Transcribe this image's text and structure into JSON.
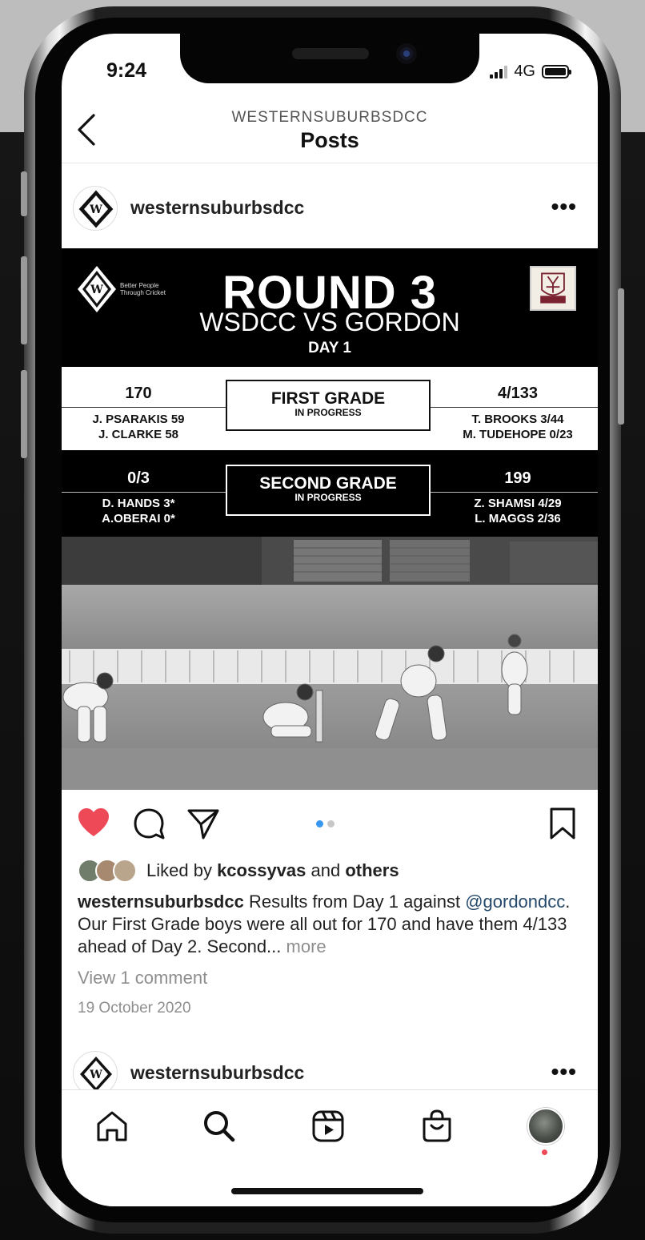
{
  "status": {
    "time": "9:24",
    "network": "4G"
  },
  "nav": {
    "account": "WESTERNSUBURBSDCC",
    "title": "Posts"
  },
  "post": {
    "username": "westernsuburbsdcc",
    "more": "•••",
    "graphic": {
      "tagline_line1": "Better People",
      "tagline_line2": "Through Cricket",
      "round": "ROUND 3",
      "match": "WSDCC VS GORDON",
      "day": "DAY 1",
      "gordon_badge": "GORDON DCC",
      "first_grade": {
        "label": "FIRST GRADE",
        "status": "IN PROGRESS",
        "left_score": "170",
        "left_line1": "J. PSARAKIS 59",
        "left_line2": "J. CLARKE 58",
        "right_score": "4/133",
        "right_line1": "T. BROOKS 3/44",
        "right_line2": "M. TUDEHOPE 0/23"
      },
      "second_grade": {
        "label": "SECOND GRADE",
        "status": "IN PROGRESS",
        "left_score": "0/3",
        "left_line1": "D. HANDS 3*",
        "left_line2": "A.OBERAI 0*",
        "right_score": "199",
        "right_line1": "Z. SHAMSI 4/29",
        "right_line2": "L. MAGGS 2/36"
      }
    },
    "carousel": {
      "count": 2,
      "active": 1
    },
    "liked": {
      "prefix": "Liked by ",
      "user": "kcossyvas",
      "and": " and ",
      "others": "others"
    },
    "caption": {
      "user": "westernsuburbsdcc",
      "text1": " Results from Day 1 against ",
      "mention": "@gordondcc",
      "text2": ". Our First Grade boys were all out for 170 and have them 4/133 ahead of Day 2. Second... ",
      "more": "more"
    },
    "view_comments": "View 1 comment",
    "date": "19 October 2020"
  },
  "next_post": {
    "username": "westernsuburbsdcc",
    "more": "•••"
  },
  "colors": {
    "like": "#ed4956",
    "carousel_active": "#3897f0",
    "carousel_inactive": "#c7c7c7",
    "mention": "#25496b"
  },
  "icons": [
    "back-chevron-icon",
    "heart-icon",
    "comment-icon",
    "share-icon",
    "bookmark-icon",
    "home-icon",
    "search-icon",
    "reels-icon",
    "shop-icon",
    "profile-avatar"
  ]
}
